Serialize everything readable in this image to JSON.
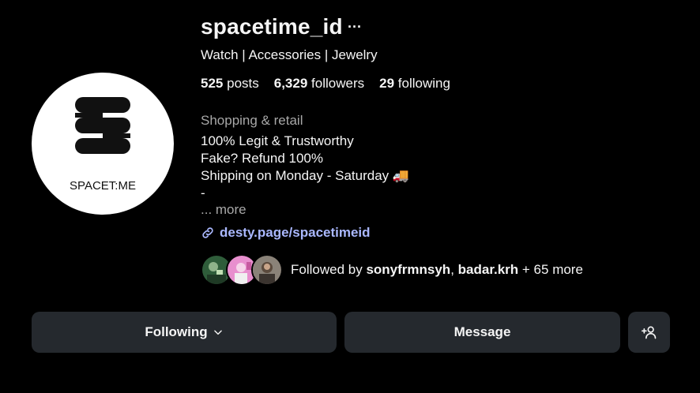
{
  "profile": {
    "username": "spacetime_id",
    "options_glyph": "···",
    "category_line": "Watch | Accessories | Jewelry",
    "avatar_logo_text": "SPACET:ME"
  },
  "stats": {
    "posts_count": "525",
    "posts_label": "posts",
    "followers_count": "6,329",
    "followers_label": "followers",
    "following_count": "29",
    "following_label": "following"
  },
  "bio": {
    "business_category": "Shopping & retail",
    "lines": [
      "100% Legit & Trustworthy",
      "Fake? Refund 100%",
      "Shipping on Monday - Saturday 🚚",
      "-"
    ],
    "more_label": "... more",
    "link_text": "desty.page/spacetimeid"
  },
  "followed_by": {
    "prefix": "Followed by ",
    "user1": "sonyfrmnsyh",
    "separator": ", ",
    "user2": "badar.krh",
    "suffix": " + 65 more"
  },
  "actions": {
    "following_label": "Following",
    "message_label": "Message"
  },
  "icons": {
    "more": "more-horizontal-icon",
    "link": "link-icon",
    "chevron": "chevron-down-icon",
    "add_person": "add-person-icon"
  },
  "colors": {
    "background": "#000000",
    "button_bg": "#25292e",
    "link": "#aab8ff",
    "muted": "#a8a8a8"
  }
}
